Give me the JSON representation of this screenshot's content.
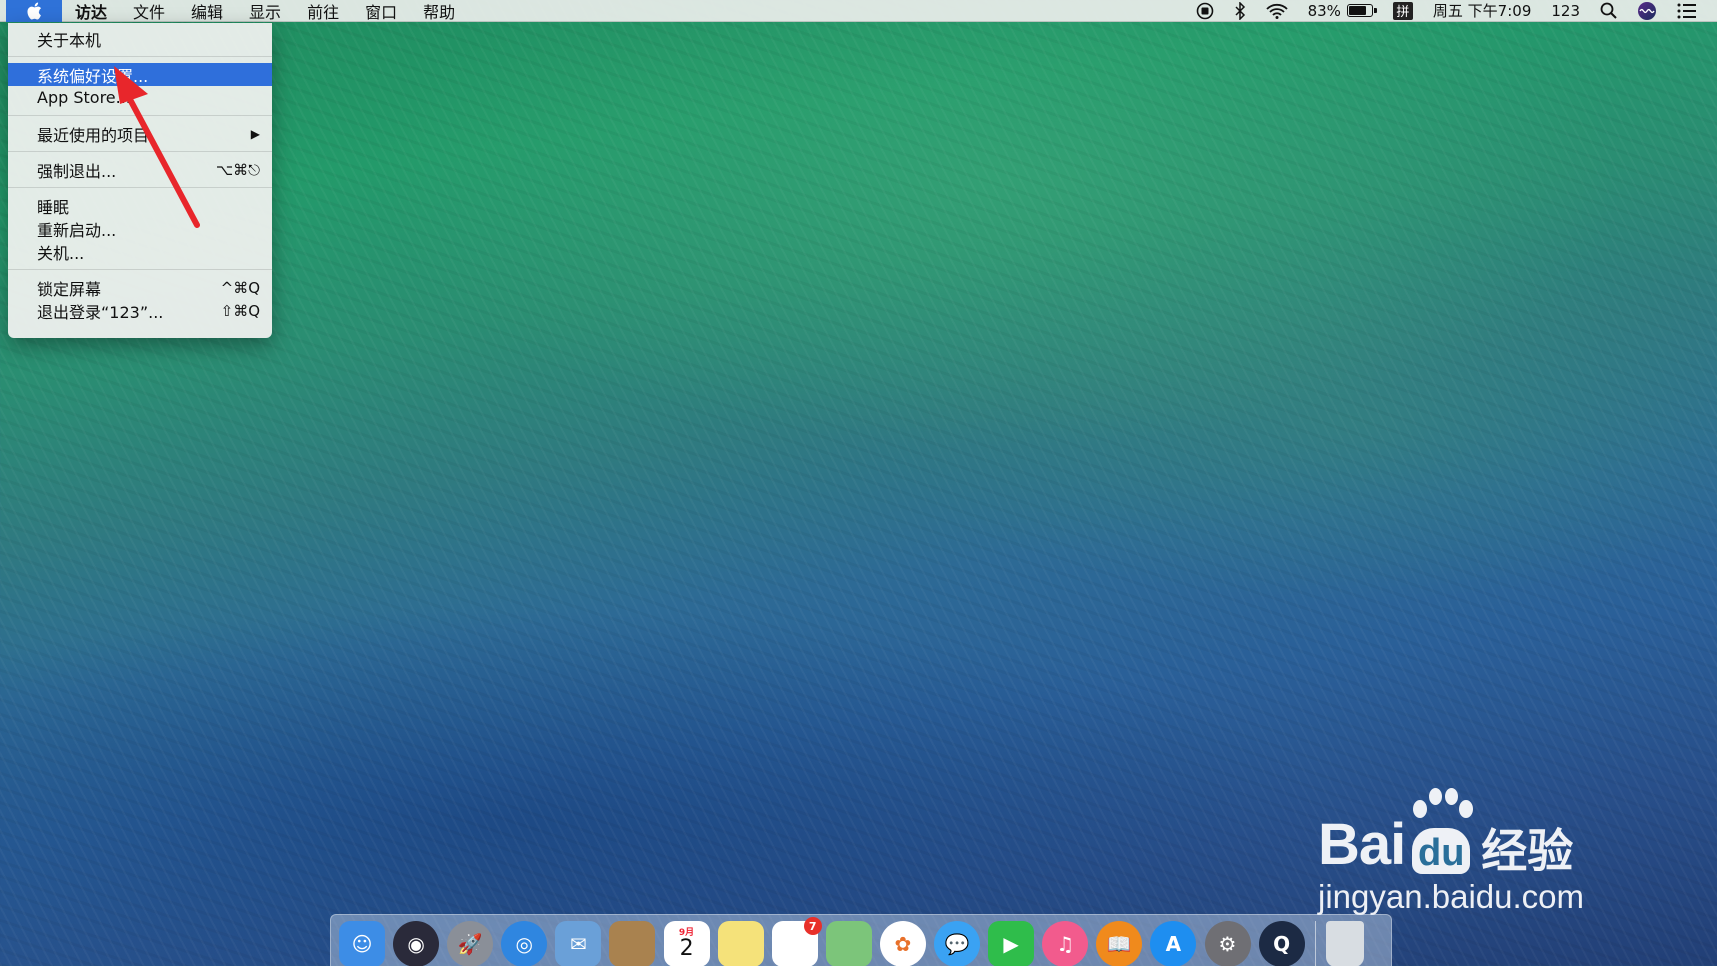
{
  "menubar": {
    "apple_icon": "apple-logo-icon",
    "menus": [
      "访达",
      "文件",
      "编辑",
      "显示",
      "前往",
      "窗口",
      "帮助"
    ],
    "status": {
      "battery_percent": "83%",
      "battery_level": 0.83,
      "input_method": "拼",
      "datetime": "周五 下午7:09",
      "user": "123"
    }
  },
  "apple_menu": {
    "about": "关于本机",
    "preferences": "系统偏好设置...",
    "app_store": "App Store...",
    "recent_items": "最近使用的项目",
    "force_quit": "强制退出...",
    "force_quit_shortcut": "⌥⌘⎋",
    "sleep": "睡眠",
    "restart": "重新启动...",
    "shutdown": "关机...",
    "lock_screen": "锁定屏幕",
    "lock_shortcut": "^⌘Q",
    "logout": "退出登录“123”...",
    "logout_shortcut": "⇧⌘Q",
    "highlighted": "preferences"
  },
  "watermark": {
    "brand_left": "Bai",
    "brand_mid": "du",
    "brand_right": "经验",
    "url": "jingyan.baidu.com"
  },
  "dock": {
    "apps": [
      {
        "name": "finder-icon",
        "color": "#3d8de6"
      },
      {
        "name": "siri-icon",
        "color": "#2a2a3a"
      },
      {
        "name": "launchpad-icon",
        "color": "#8a8f98"
      },
      {
        "name": "safari-icon",
        "color": "#2f86e0"
      },
      {
        "name": "mail-icon",
        "color": "#6aa0d8"
      },
      {
        "name": "contacts-icon",
        "color": "#a9824f"
      },
      {
        "name": "calendar-icon",
        "color": "#ffffff",
        "label": "2",
        "month": "9月"
      },
      {
        "name": "notes-icon",
        "color": "#f5e27a"
      },
      {
        "name": "reminders-icon",
        "color": "#ffffff",
        "badge": "7"
      },
      {
        "name": "maps-icon",
        "color": "#7cc57a"
      },
      {
        "name": "photos-icon",
        "color": "#ffffff"
      },
      {
        "name": "messages-icon",
        "color": "#3aa2f3"
      },
      {
        "name": "facetime-icon",
        "color": "#2fbd4b"
      },
      {
        "name": "itunes-icon",
        "color": "#f25b8d"
      },
      {
        "name": "ibooks-icon",
        "color": "#f08a1c"
      },
      {
        "name": "app-store-icon",
        "color": "#1e8ef0"
      },
      {
        "name": "system-preferences-icon",
        "color": "#6f6f74"
      },
      {
        "name": "quicktime-icon",
        "color": "#1c2a44"
      }
    ],
    "trash": {
      "name": "trash-icon",
      "color": "#d8dde2"
    }
  }
}
